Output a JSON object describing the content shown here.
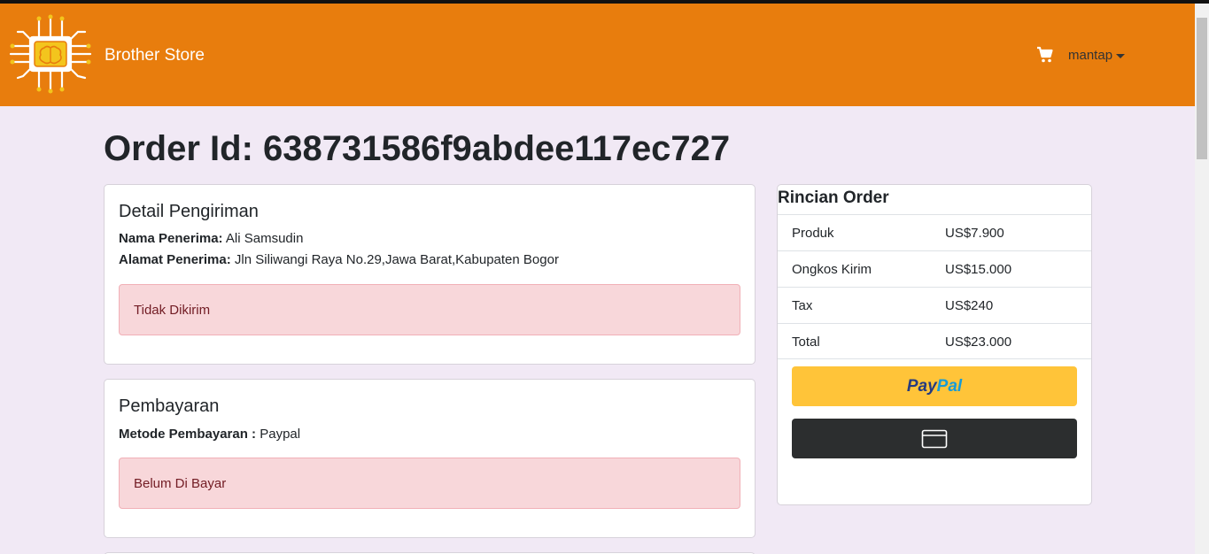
{
  "navbar": {
    "brand": "Brother Store",
    "user_menu_label": "mantap",
    "bg_color": "#e87d0d"
  },
  "page": {
    "title": "Order Id: 638731586f9abdee117ec727"
  },
  "shipping": {
    "heading": "Detail Pengiriman",
    "recipient_label": "Nama Penerima:",
    "recipient_value": "Ali Samsudin",
    "address_label": "Alamat Penerima:",
    "address_value": "Jln Siliwangi Raya No.29,Jawa Barat,Kabupaten Bogor",
    "status": "Tidak Dikirim"
  },
  "payment": {
    "heading": "Pembayaran",
    "method_label": "Metode Pembayaran :",
    "method_value": "Paypal",
    "status": "Belum Di Bayar"
  },
  "order_summary": {
    "heading": "Rincian Order",
    "rows": [
      {
        "label": "Produk",
        "value": "US$7.900"
      },
      {
        "label": "Ongkos Kirim",
        "value": "US$15.000"
      },
      {
        "label": "Tax",
        "value": "US$240"
      },
      {
        "label": "Total",
        "value": "US$23.000"
      }
    ],
    "paypal_button": {
      "pay": "Pay",
      "pal": "Pal",
      "pay_color": "#253b80",
      "pal_color": "#179bd7"
    },
    "card_button_icon": "credit-card-icon"
  }
}
